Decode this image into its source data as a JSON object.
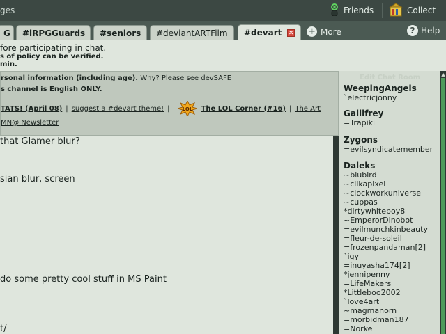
{
  "topbar": {
    "left_text": "ges",
    "friends_label": "Friends",
    "collect_label": "Collect"
  },
  "tabs": [
    {
      "label": "G"
    },
    {
      "label": "#iRPGGuards"
    },
    {
      "label": "#seniors"
    },
    {
      "label": "#deviantARTFilm"
    },
    {
      "label": "#devart"
    }
  ],
  "more_label": "More",
  "help_label": "Help",
  "notice": {
    "line1": "fore participating in chat.",
    "line2": "s of policy can be verified.",
    "line3": "min."
  },
  "topic": {
    "line1_bold": "rsonal information (including age).",
    "line1_rest": " Why? Please see ",
    "line1_link": "devSAFE",
    "line2": "s channel is English ONLY.",
    "stats_link": "TATS! (April 08)",
    "suggest_link": "suggest a #devart theme!",
    "lol_link": "The LOL Corner (#16)",
    "art_link": "The Art",
    "newsletter_link": "MN@ Newsletter"
  },
  "edit_button_label": "Edit Chat Room",
  "messages": [
    {
      "text": "that Glamer blur?"
    },
    {
      "text": "sian blur, screen"
    },
    {
      "text": " do some pretty cool stuff in MS Paint"
    },
    {
      "text": "t/"
    }
  ],
  "userlist": {
    "groups": [
      {
        "name": "WeepingAngels",
        "members": [
          "`electricjonny"
        ]
      },
      {
        "name": "Gallifrey",
        "members": [
          "=Trapiki"
        ]
      },
      {
        "name": "Zygons",
        "members": [
          "=evilsyndicatemember"
        ]
      },
      {
        "name": "Daleks",
        "members": [
          "~blubird",
          "~clikapixel",
          "~clockworkuniverse",
          "~cuppas",
          "*dirtywhiteboy8",
          "~EmperorDinobot",
          "=evilmunchkinbeauty",
          "=fleur-de-soleil",
          "=frozenpandaman[2]",
          "`igy",
          "=inuyasha174[2]",
          "*jennipenny",
          "=LifeMakers",
          "*Littleboo2002",
          "`love4art",
          "~magmanorn",
          "=morbidman187",
          "=Norke"
        ]
      }
    ]
  }
}
